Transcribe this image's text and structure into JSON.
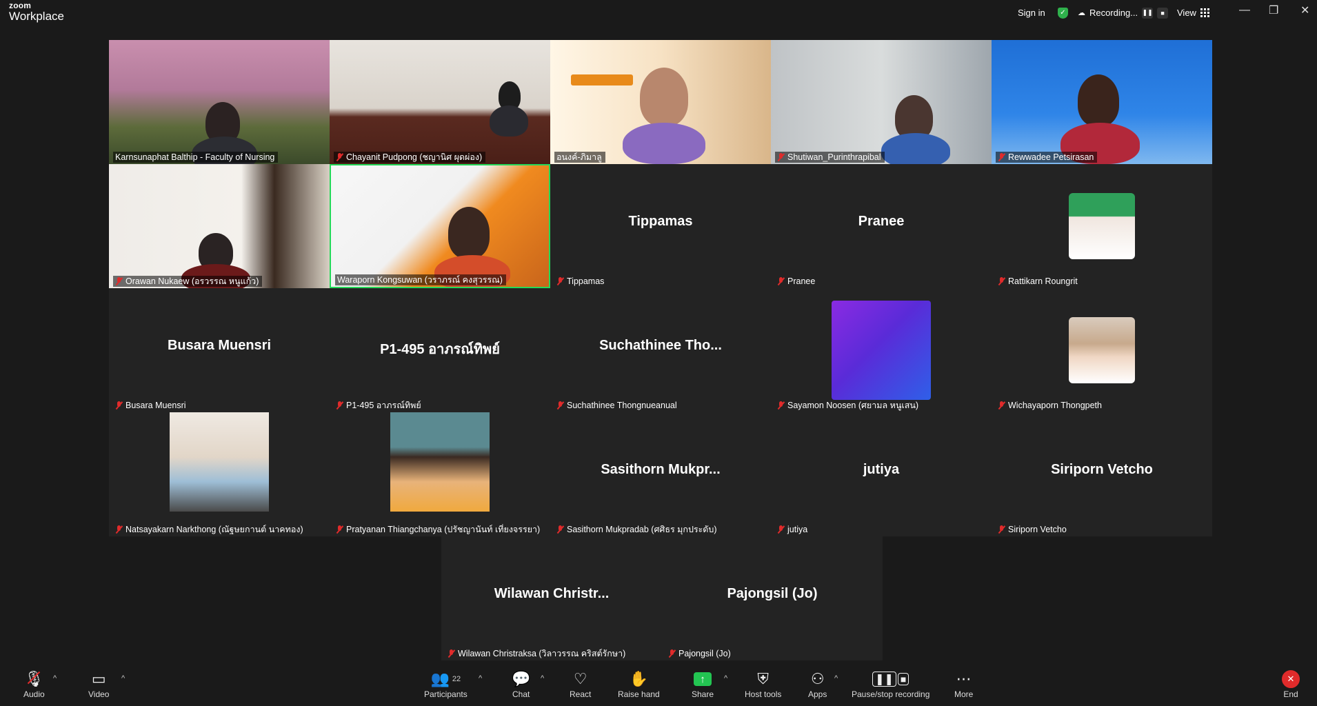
{
  "app": {
    "brand_top": "zoom",
    "brand_bottom": "Workplace"
  },
  "titlebar": {
    "sign_in": "Sign in",
    "recording_label": "Recording...",
    "view_label": "View",
    "shield_icon": "shield-check-icon",
    "minimize_icon": "minimize-icon",
    "restore_icon": "restore-icon",
    "close_icon": "close-icon"
  },
  "colors": {
    "active_speaker_border": "#23d959",
    "muted_icon": "#e02b2b",
    "share_button": "#23c552",
    "end_button": "#e02b2b",
    "shield": "#2fb14c"
  },
  "participants_grid": [
    {
      "name": "Karnsunaphat Balthip - Faculty of Nursing",
      "video": true,
      "muted": false
    },
    {
      "name": "Chayanit Pudpong (ชญานิศ ผุดผ่อง)",
      "video": true,
      "muted": true
    },
    {
      "name": "อนงค์-ภิมาลู",
      "video": true,
      "muted": false
    },
    {
      "name": "Shutiwan_Purinthrapibal",
      "video": true,
      "muted": true
    },
    {
      "name": "Rewwadee Petsirasan",
      "video": true,
      "muted": true
    },
    {
      "name": "Orawan Nukaew (อรวรรณ หนูแก้ว)",
      "video": true,
      "muted": true
    },
    {
      "name": "Waraporn Kongsuwan (วราภรณ์ คงสุวรรณ)",
      "video": true,
      "muted": false,
      "active": true
    },
    {
      "name": "Tippamas",
      "display_name": "Tippamas",
      "video": false,
      "muted": true
    },
    {
      "name": "Pranee",
      "display_name": "Pranee",
      "video": false,
      "muted": true
    },
    {
      "name": "Rattikarn Roungrit",
      "video": false,
      "avatar": true,
      "muted": true
    },
    {
      "name": "Busara Muensri",
      "display_name": "Busara Muensri",
      "video": false,
      "muted": true
    },
    {
      "name": "P1-495 อาภรณ์ทิพย์",
      "display_name": "P1-495 อาภรณ์ทิพย์",
      "video": false,
      "muted": true
    },
    {
      "name": "Suchathinee Thongnueanual",
      "display_name": "Suchathinee  Tho...",
      "video": false,
      "muted": true
    },
    {
      "name": "Sayamon Noosen (ศยามล หนูเสน)",
      "video": false,
      "avatar": true,
      "muted": true
    },
    {
      "name": "Wichayaporn Thongpeth",
      "video": false,
      "avatar": true,
      "muted": true
    },
    {
      "name": "Natsayakarn Narkthong (ณัฐษยกานต์ นาคทอง)",
      "video": false,
      "avatar": true,
      "muted": true
    },
    {
      "name": "Pratyanan Thiangchanya (ปรัชญานันท์ เที่ยงจรรยา)",
      "video": false,
      "avatar": true,
      "muted": true
    },
    {
      "name": "Sasithorn Mukpradab (ศศิธร มุกประดับ)",
      "display_name": "Sasithorn  Mukpr...",
      "video": false,
      "muted": true
    },
    {
      "name": "jutiya",
      "display_name": "jutiya",
      "video": false,
      "muted": true
    },
    {
      "name": "Siriporn Vetcho",
      "display_name": "Siriporn Vetcho",
      "video": false,
      "muted": true
    }
  ],
  "participants_bottom": [
    {
      "name": "Wilawan Christraksa (วิลาวรรณ คริสต์รักษา)",
      "display_name": "Wilawan  Christr...",
      "muted": true
    },
    {
      "name": "Pajongsil (Jo)",
      "display_name": "Pajongsil (Jo)",
      "muted": true
    }
  ],
  "toolbar": {
    "audio": "Audio",
    "video": "Video",
    "participants": "Participants",
    "participants_count": "22",
    "chat": "Chat",
    "react": "React",
    "raise_hand": "Raise hand",
    "share": "Share",
    "host_tools": "Host tools",
    "apps": "Apps",
    "pause_stop_recording": "Pause/stop recording",
    "more": "More",
    "end": "End"
  }
}
